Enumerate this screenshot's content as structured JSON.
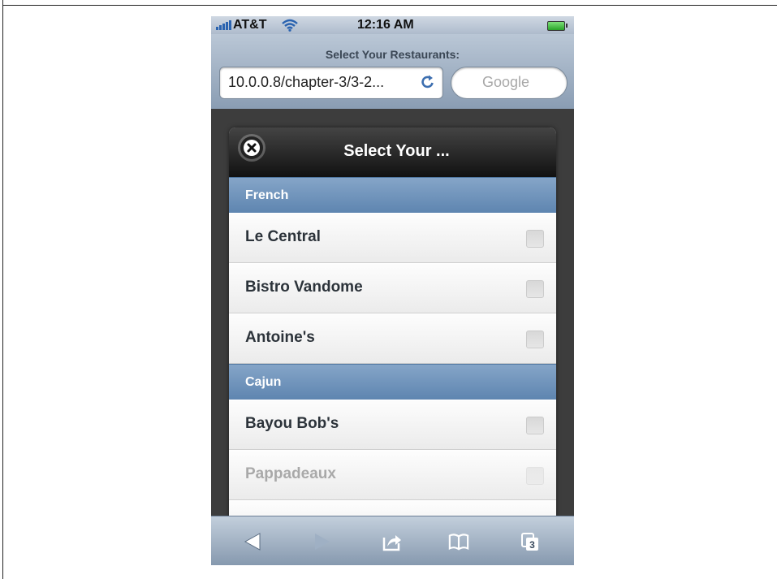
{
  "status_bar": {
    "carrier": "AT&T",
    "time": "12:16 AM"
  },
  "browser": {
    "page_title": "Select Your Restaurants:",
    "url": "10.0.0.8/chapter-3/3-2...",
    "search_placeholder": "Google",
    "tabs_count": "3"
  },
  "dialog": {
    "title": "Select Your ...",
    "groups": [
      {
        "label": "French",
        "items": [
          {
            "label": "Le Central",
            "checked": false,
            "disabled": false
          },
          {
            "label": "Bistro Vandome",
            "checked": false,
            "disabled": false
          },
          {
            "label": "Antoine's",
            "checked": false,
            "disabled": false
          }
        ]
      },
      {
        "label": "Cajun",
        "items": [
          {
            "label": "Bayou Bob's",
            "checked": false,
            "disabled": false
          },
          {
            "label": "Pappadeaux",
            "checked": false,
            "disabled": true
          }
        ]
      }
    ]
  },
  "toolbar": {
    "icons": [
      "back-icon",
      "forward-icon",
      "share-icon",
      "bookmarks-icon",
      "tabs-icon"
    ]
  },
  "colors": {
    "divider": "#6b8fb8",
    "accent": "#2a63b0"
  }
}
